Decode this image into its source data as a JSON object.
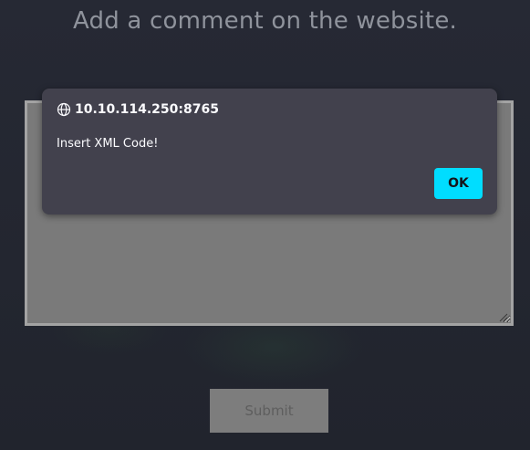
{
  "page": {
    "heading": "Add a comment on the website."
  },
  "form": {
    "comment_value": "",
    "submit_label": "Submit"
  },
  "dialog": {
    "origin": "10.10.114.250:8765",
    "message": "Insert XML Code!",
    "ok_label": "OK",
    "icon": "globe-icon"
  },
  "colors": {
    "page_background": "#23262f",
    "dialog_background": "#42414d",
    "accent": "#00ddff",
    "textarea_background": "#7a7a7a",
    "submit_background": "#7d7d7d"
  }
}
